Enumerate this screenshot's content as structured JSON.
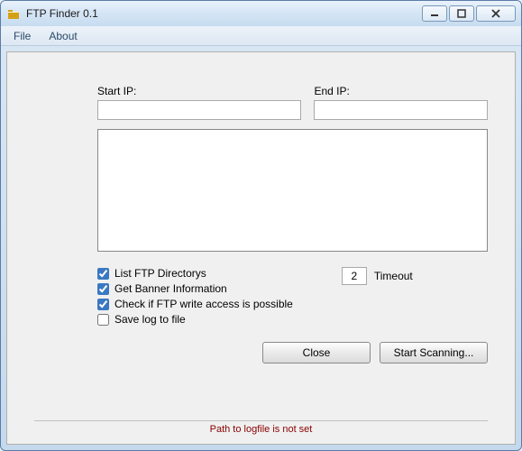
{
  "window": {
    "title": "FTP Finder 0.1"
  },
  "menu": {
    "file": "File",
    "about": "About"
  },
  "form": {
    "start_ip_label": "Start IP:",
    "start_ip_value": "",
    "end_ip_label": "End IP:",
    "end_ip_value": "",
    "results_value": ""
  },
  "options": {
    "list_dirs": {
      "label": "List FTP Directorys",
      "checked": true
    },
    "banner": {
      "label": "Get Banner Information",
      "checked": true
    },
    "write_access": {
      "label": "Check if FTP write access is possible",
      "checked": true
    },
    "save_log": {
      "label": "Save log to file",
      "checked": false
    },
    "timeout_label": "Timeout",
    "timeout_value": "2"
  },
  "buttons": {
    "close": "Close",
    "start": "Start Scanning..."
  },
  "status": {
    "message": "Path to logfile is not set"
  }
}
